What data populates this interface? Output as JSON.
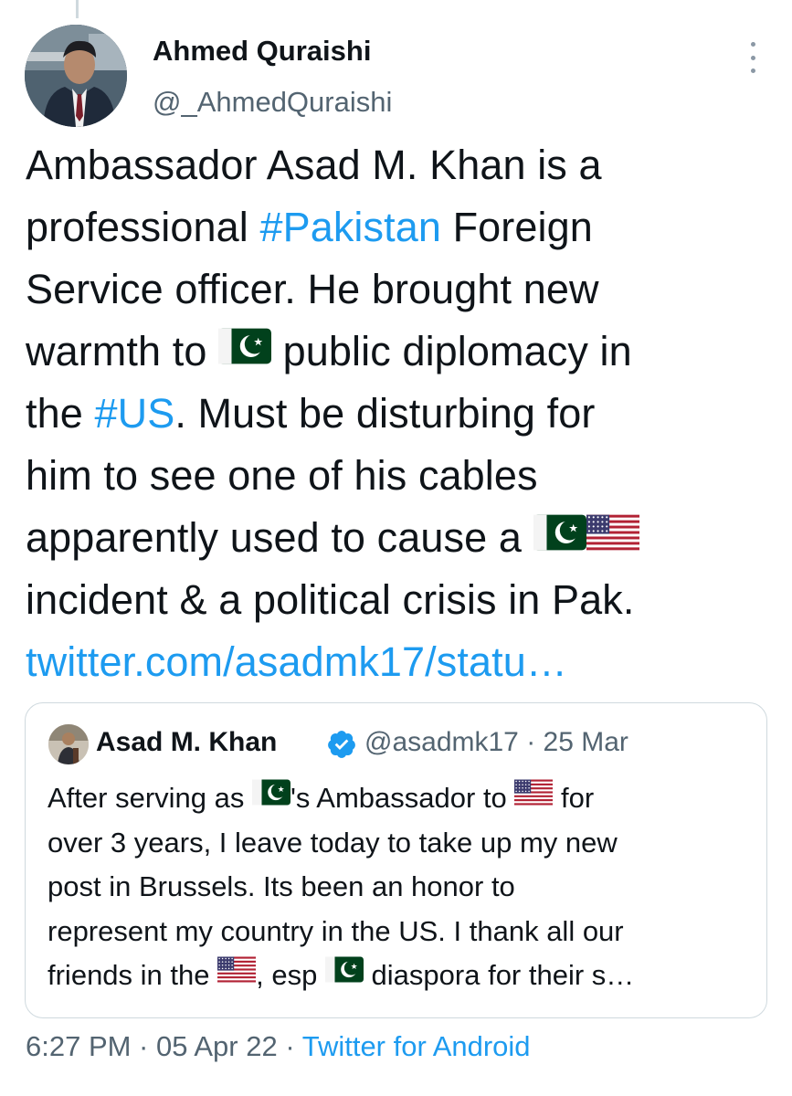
{
  "author": {
    "name": "Ahmed Quraishi",
    "handle": "@_AhmedQuraishi"
  },
  "tweet": {
    "lines": [
      [
        {
          "t": "Ambassador Asad M. Khan is a"
        }
      ],
      [
        {
          "t": "professional "
        },
        {
          "t": "#Pakistan",
          "k": "hashtag"
        },
        {
          "t": " Foreign"
        }
      ],
      [
        {
          "t": "Service officer. He brought new"
        }
      ],
      [
        {
          "t": "warmth to "
        },
        {
          "flag": "pk"
        },
        {
          "t": " public diplomacy in"
        }
      ],
      [
        {
          "t": "the "
        },
        {
          "t": "#US",
          "k": "hashtag"
        },
        {
          "t": ". Must be disturbing for"
        }
      ],
      [
        {
          "t": "him to see one of his cables"
        }
      ],
      [
        {
          "t": "apparently used to cause a "
        },
        {
          "flag": "pk"
        },
        {
          "flag": "us"
        }
      ],
      [
        {
          "t": "incident & a political crisis in Pak."
        }
      ],
      [
        {
          "t": "twitter.com/asadmk17/statu…",
          "k": "link"
        }
      ]
    ]
  },
  "quote": {
    "name": "Asad M. Khan",
    "handle_date": "@asadmk17 · 25 Mar",
    "lines": [
      [
        {
          "t": "After serving as "
        },
        {
          "flag": "pk"
        },
        {
          "t": "'s Ambassador to "
        },
        {
          "flag": "us"
        },
        {
          "t": " for"
        }
      ],
      [
        {
          "t": "over 3 years, I leave today to take up my new"
        }
      ],
      [
        {
          "t": "post in Brussels. Its been an honor to"
        }
      ],
      [
        {
          "t": "represent my country in the US. I thank all our"
        }
      ],
      [
        {
          "t": "friends in the "
        },
        {
          "flag": "us"
        },
        {
          "t": ", esp "
        },
        {
          "flag": "pk"
        },
        {
          "t": " diaspora for their s…"
        }
      ]
    ]
  },
  "meta": {
    "time_date": "6:27 PM · 05 Apr 22 · ",
    "source": "Twitter for Android"
  },
  "icons": {
    "more": "more-vertical-icon",
    "verified": "verified-badge-icon",
    "flag_pk": "pakistan-flag-icon",
    "flag_us": "usa-flag-icon"
  },
  "colors": {
    "link": "#1d9bf0",
    "secondary": "#536471",
    "border": "#cfd9de",
    "text": "#0f1419"
  }
}
